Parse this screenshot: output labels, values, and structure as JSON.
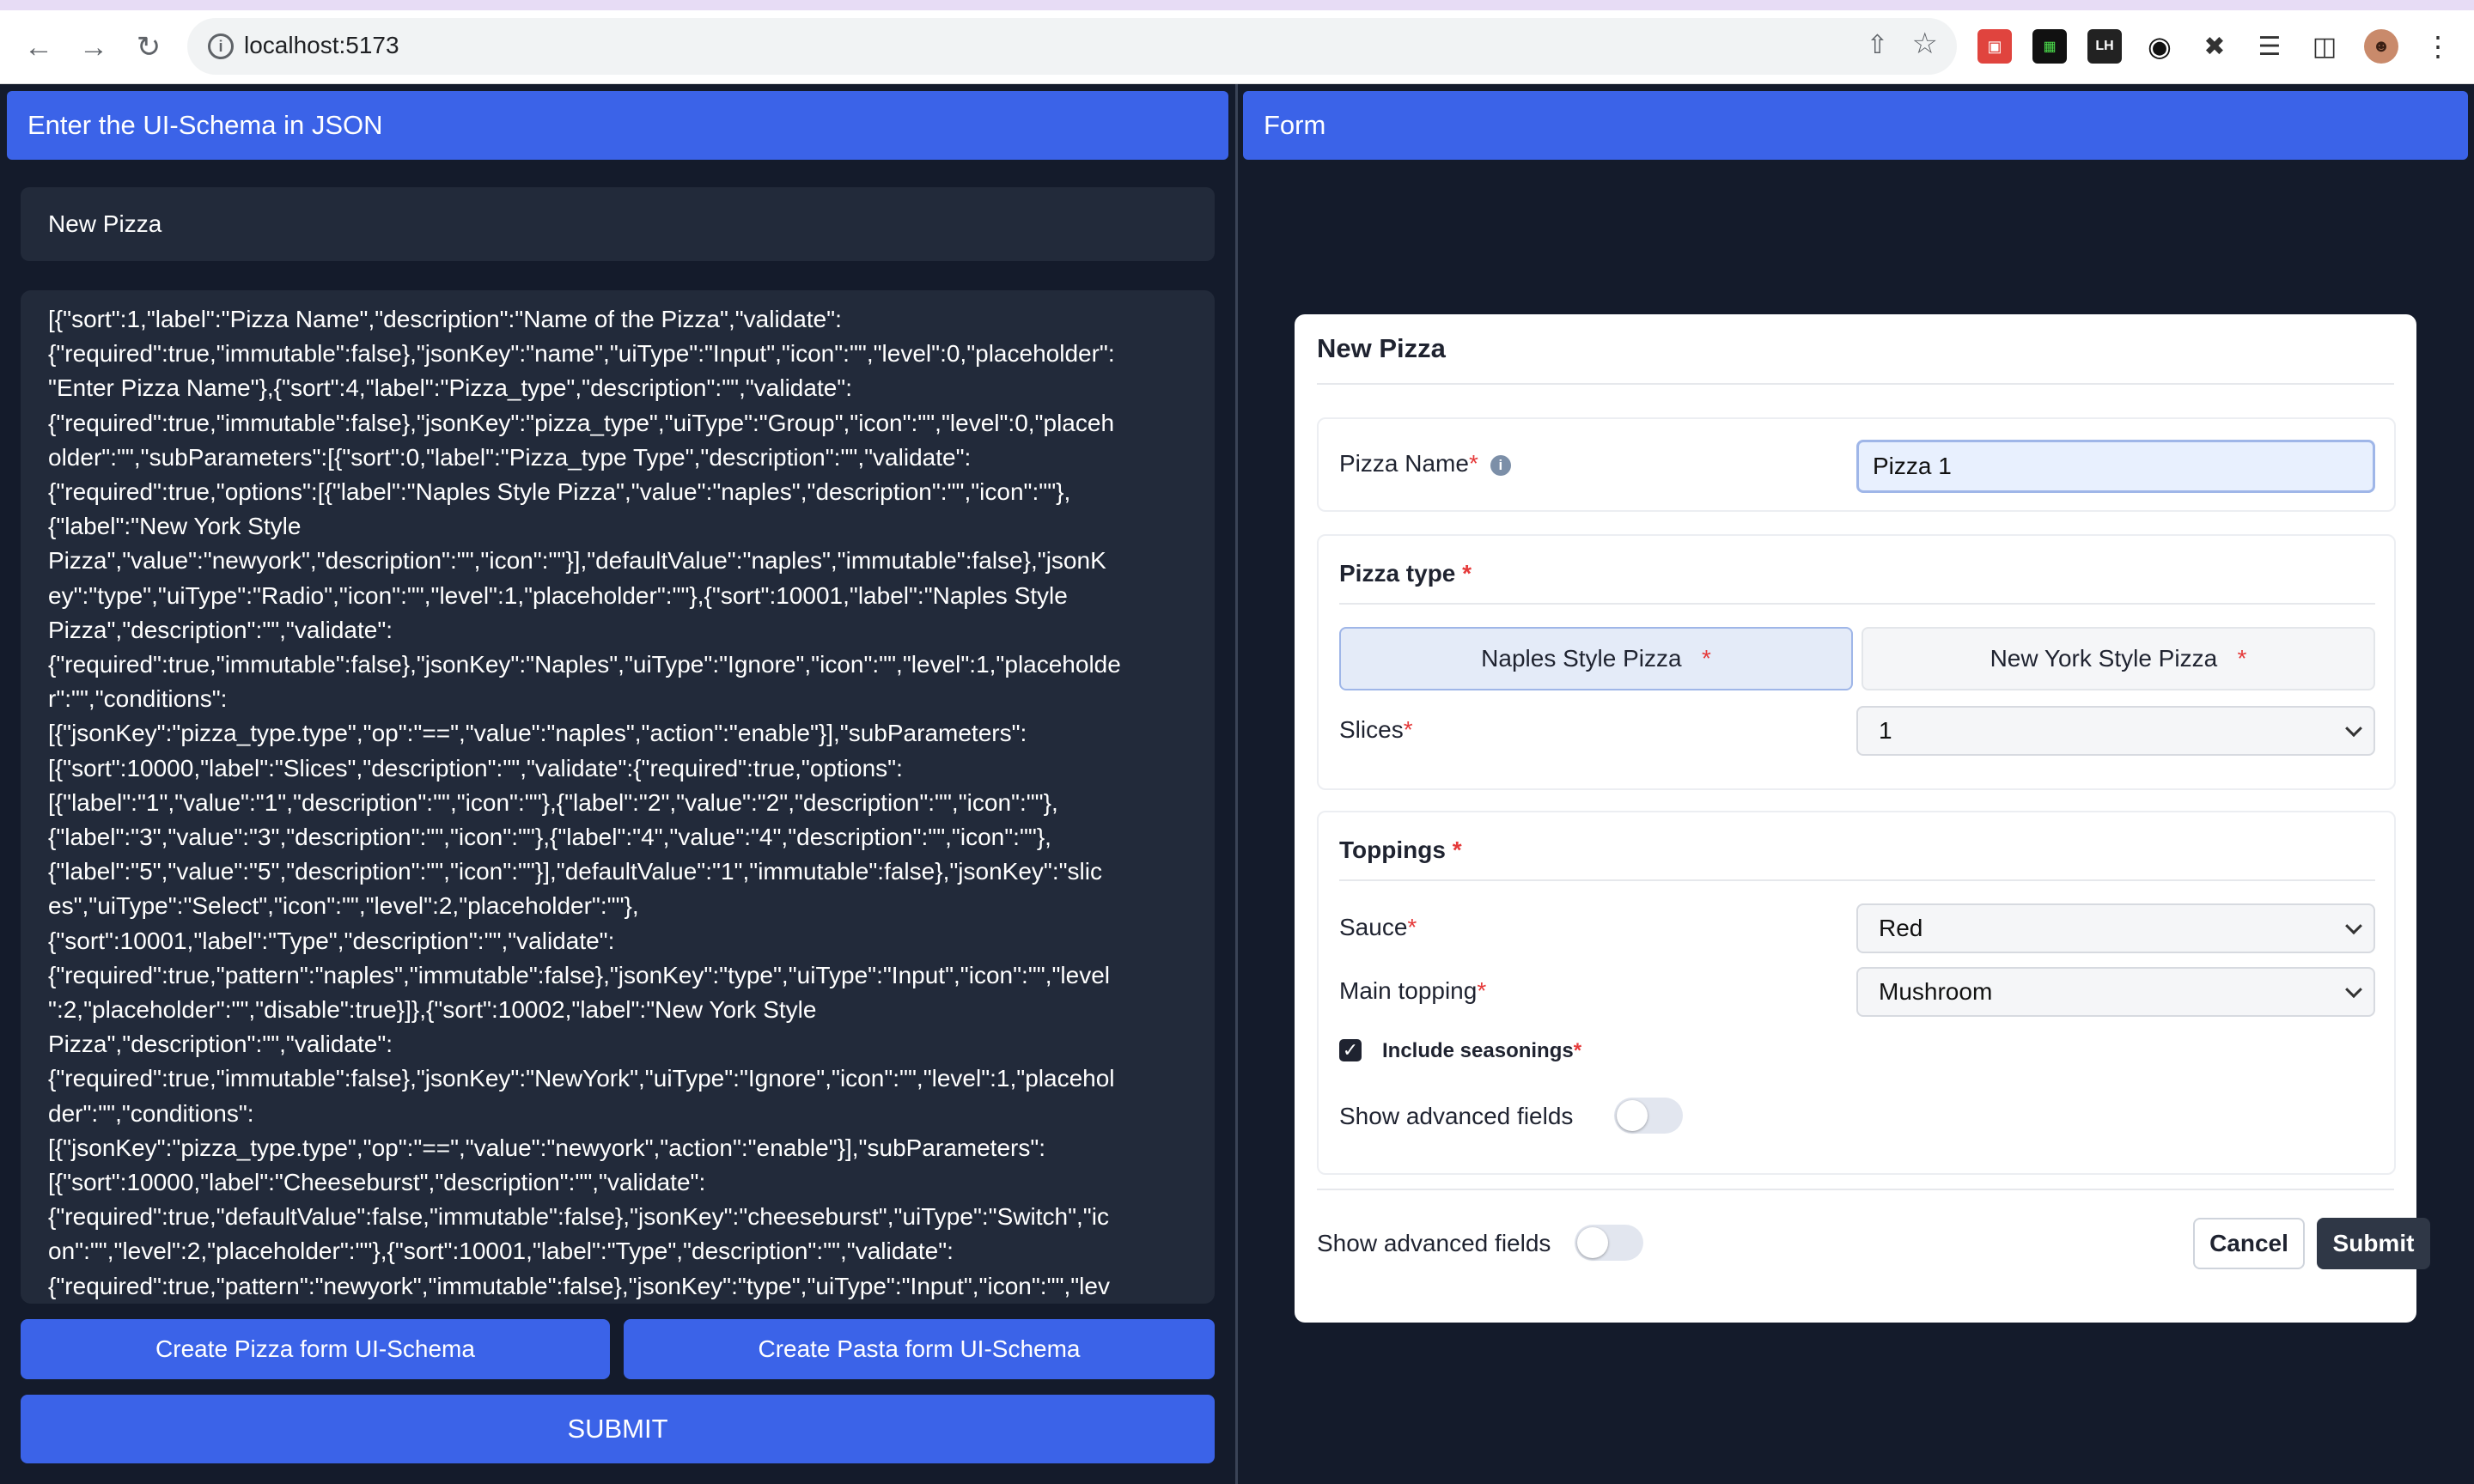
{
  "browser": {
    "url": "localhost:5173"
  },
  "left": {
    "header": "Enter the UI-Schema in JSON",
    "schema_name": "New Pizza",
    "schema_json": "[{\"sort\":1,\"label\":\"Pizza Name\",\"description\":\"Name of the Pizza\",\"validate\":\n{\"required\":true,\"immutable\":false},\"jsonKey\":\"name\",\"uiType\":\"Input\",\"icon\":\"\",\"level\":0,\"placeholder\":\n\"Enter Pizza Name\"},{\"sort\":4,\"label\":\"Pizza_type\",\"description\":\"\",\"validate\":\n{\"required\":true,\"immutable\":false},\"jsonKey\":\"pizza_type\",\"uiType\":\"Group\",\"icon\":\"\",\"level\":0,\"placeh\nolder\":\"\",\"subParameters\":[{\"sort\":0,\"label\":\"Pizza_type Type\",\"description\":\"\",\"validate\":\n{\"required\":true,\"options\":[{\"label\":\"Naples Style Pizza\",\"value\":\"naples\",\"description\":\"\",\"icon\":\"\"},\n{\"label\":\"New York Style\nPizza\",\"value\":\"newyork\",\"description\":\"\",\"icon\":\"\"}],\"defaultValue\":\"naples\",\"immutable\":false},\"jsonK\ney\":\"type\",\"uiType\":\"Radio\",\"icon\":\"\",\"level\":1,\"placeholder\":\"\"},{\"sort\":10001,\"label\":\"Naples Style\nPizza\",\"description\":\"\",\"validate\":\n{\"required\":true,\"immutable\":false},\"jsonKey\":\"Naples\",\"uiType\":\"Ignore\",\"icon\":\"\",\"level\":1,\"placeholde\nr\":\"\",\"conditions\":\n[{\"jsonKey\":\"pizza_type.type\",\"op\":\"==\",\"value\":\"naples\",\"action\":\"enable\"}],\"subParameters\":\n[{\"sort\":10000,\"label\":\"Slices\",\"description\":\"\",\"validate\":{\"required\":true,\"options\":\n[{\"label\":\"1\",\"value\":\"1\",\"description\":\"\",\"icon\":\"\"},{\"label\":\"2\",\"value\":\"2\",\"description\":\"\",\"icon\":\"\"},\n{\"label\":\"3\",\"value\":\"3\",\"description\":\"\",\"icon\":\"\"},{\"label\":\"4\",\"value\":\"4\",\"description\":\"\",\"icon\":\"\"},\n{\"label\":\"5\",\"value\":\"5\",\"description\":\"\",\"icon\":\"\"}],\"defaultValue\":\"1\",\"immutable\":false},\"jsonKey\":\"slic\nes\",\"uiType\":\"Select\",\"icon\":\"\",\"level\":2,\"placeholder\":\"\"},\n{\"sort\":10001,\"label\":\"Type\",\"description\":\"\",\"validate\":\n{\"required\":true,\"pattern\":\"naples\",\"immutable\":false},\"jsonKey\":\"type\",\"uiType\":\"Input\",\"icon\":\"\",\"level\n\":2,\"placeholder\":\"\",\"disable\":true}]},{\"sort\":10002,\"label\":\"New York Style\nPizza\",\"description\":\"\",\"validate\":\n{\"required\":true,\"immutable\":false},\"jsonKey\":\"NewYork\",\"uiType\":\"Ignore\",\"icon\":\"\",\"level\":1,\"placehol\nder\":\"\",\"conditions\":\n[{\"jsonKey\":\"pizza_type.type\",\"op\":\"==\",\"value\":\"newyork\",\"action\":\"enable\"}],\"subParameters\":\n[{\"sort\":10000,\"label\":\"Cheeseburst\",\"description\":\"\",\"validate\":\n{\"required\":true,\"defaultValue\":false,\"immutable\":false},\"jsonKey\":\"cheeseburst\",\"uiType\":\"Switch\",\"ic\non\":\"\",\"level\":2,\"placeholder\":\"\"},{\"sort\":10001,\"label\":\"Type\",\"description\":\"\",\"validate\":\n{\"required\":true,\"pattern\":\"newyork\",\"immutable\":false},\"jsonKey\":\"type\",\"uiType\":\"Input\",\"icon\":\"\",\"lev",
    "btn_pizza": "Create Pizza form UI-Schema",
    "btn_pasta": "Create Pasta form UI-Schema",
    "btn_submit": "SUBMIT"
  },
  "right": {
    "header": "Form",
    "card_title": "New Pizza",
    "pizza_name_label": "Pizza Name",
    "pizza_name_value": "Pizza 1",
    "pizza_type_title": "Pizza type",
    "seg_naples": "Naples Style Pizza",
    "seg_newyork": "New York Style Pizza",
    "slices_label": "Slices",
    "slices_value": "1",
    "toppings_title": "Toppings",
    "sauce_label": "Sauce",
    "sauce_value": "Red",
    "main_topping_label": "Main topping",
    "main_topping_value": "Mushroom",
    "seasonings_label": "Include seasonings",
    "seasonings_checked": true,
    "adv_inner_label": "Show advanced fields",
    "adv_outer_label": "Show advanced fields",
    "cancel_label": "Cancel",
    "submit_label": "Submit",
    "required_mark": "*"
  },
  "colors": {
    "accent": "#3b63e8",
    "background": "#141b2b",
    "panel": "#222a3a",
    "required": "#e53a3a"
  }
}
